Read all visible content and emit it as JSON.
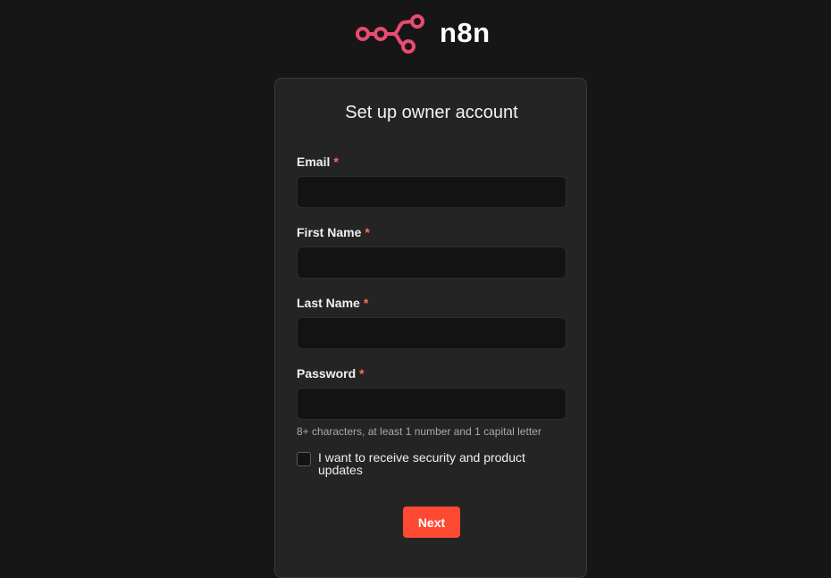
{
  "brand": {
    "name": "n8n",
    "logo_icon": "n8n-logo-icon",
    "accent_color": "#EA4B71"
  },
  "form": {
    "title": "Set up owner account",
    "required_marker": "*",
    "fields": {
      "email": {
        "label": "Email",
        "value": "",
        "placeholder": ""
      },
      "first_name": {
        "label": "First Name",
        "value": "",
        "placeholder": ""
      },
      "last_name": {
        "label": "Last Name",
        "value": "",
        "placeholder": ""
      },
      "password": {
        "label": "Password",
        "value": "",
        "placeholder": ""
      }
    },
    "password_hint": "8+ characters, at least 1 number and 1 capital letter",
    "updates_checkbox": {
      "label": "I want to receive security and product updates",
      "checked": false
    },
    "submit_label": "Next",
    "submit_color": "#FF4A33"
  }
}
